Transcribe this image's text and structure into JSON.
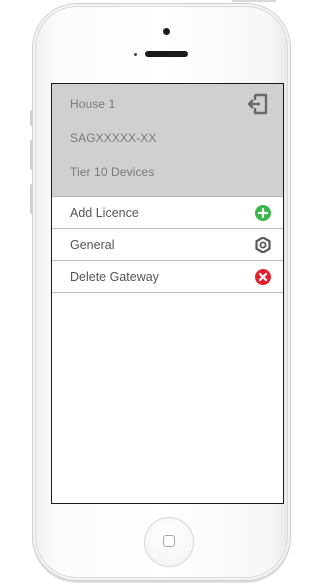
{
  "header": {
    "house_name": "House 1",
    "gateway_id": "SAGXXXXX-XX",
    "tier": "Tier 10 Devices",
    "logout_icon": "logout-icon"
  },
  "menu": {
    "items": [
      {
        "label": "Add Licence",
        "icon": "add-icon",
        "color": "#39b54a"
      },
      {
        "label": "General",
        "icon": "gear-icon",
        "color": "#595959"
      },
      {
        "label": "Delete Gateway",
        "icon": "delete-icon",
        "color": "#e3202e"
      }
    ]
  },
  "colors": {
    "header_bg": "#d0d0d0",
    "header_text": "#7a7a7a",
    "item_text": "#555555"
  }
}
